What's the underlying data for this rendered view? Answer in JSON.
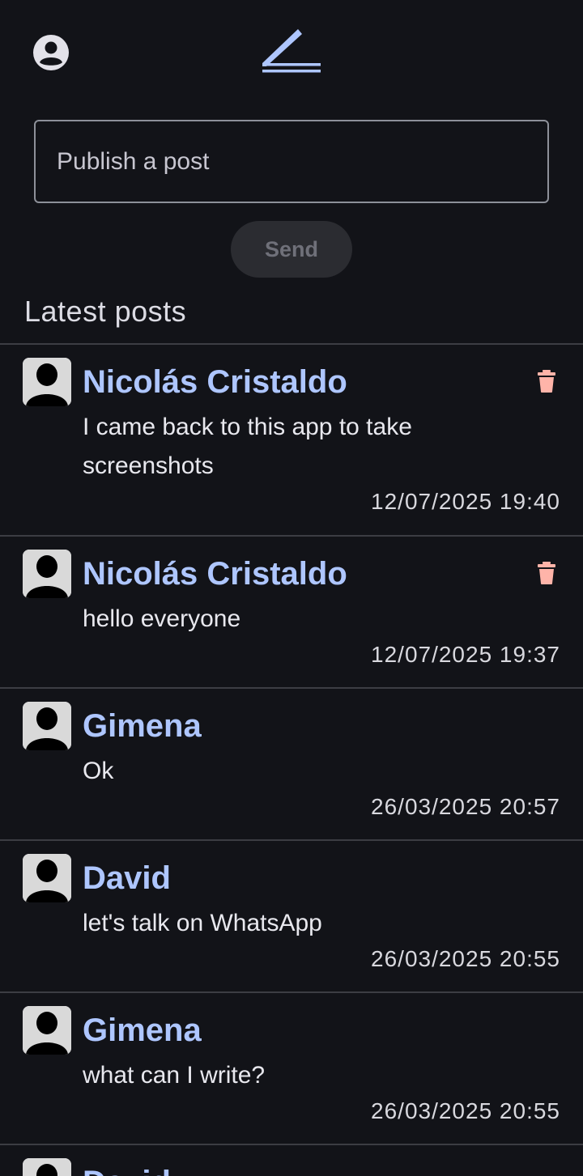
{
  "header": {
    "profile_icon": "account-circle-icon",
    "logo_icon": "edit-pen-logo-icon"
  },
  "composer": {
    "placeholder": "Publish a post",
    "send_label": "Send"
  },
  "feed": {
    "title": "Latest posts",
    "posts": [
      {
        "author": "Nicolás Cristaldo",
        "text": "I came back to this app to take screenshots",
        "timestamp": "12/07/2025 19:40",
        "deletable": true
      },
      {
        "author": "Nicolás Cristaldo",
        "text": "hello everyone",
        "timestamp": "12/07/2025 19:37",
        "deletable": true
      },
      {
        "author": "Gimena",
        "text": "Ok",
        "timestamp": "26/03/2025 20:57",
        "deletable": false
      },
      {
        "author": "David",
        "text": "let's talk on WhatsApp",
        "timestamp": "26/03/2025 20:55",
        "deletable": false
      },
      {
        "author": "Gimena",
        "text": "what can I write?",
        "timestamp": "26/03/2025 20:55",
        "deletable": false
      },
      {
        "author": "David",
        "text": "",
        "timestamp": "",
        "deletable": false
      }
    ]
  },
  "colors": {
    "background": "#121318",
    "accent": "#aec6ff",
    "delete": "#ffb4a9",
    "divider": "#3c3d43"
  }
}
